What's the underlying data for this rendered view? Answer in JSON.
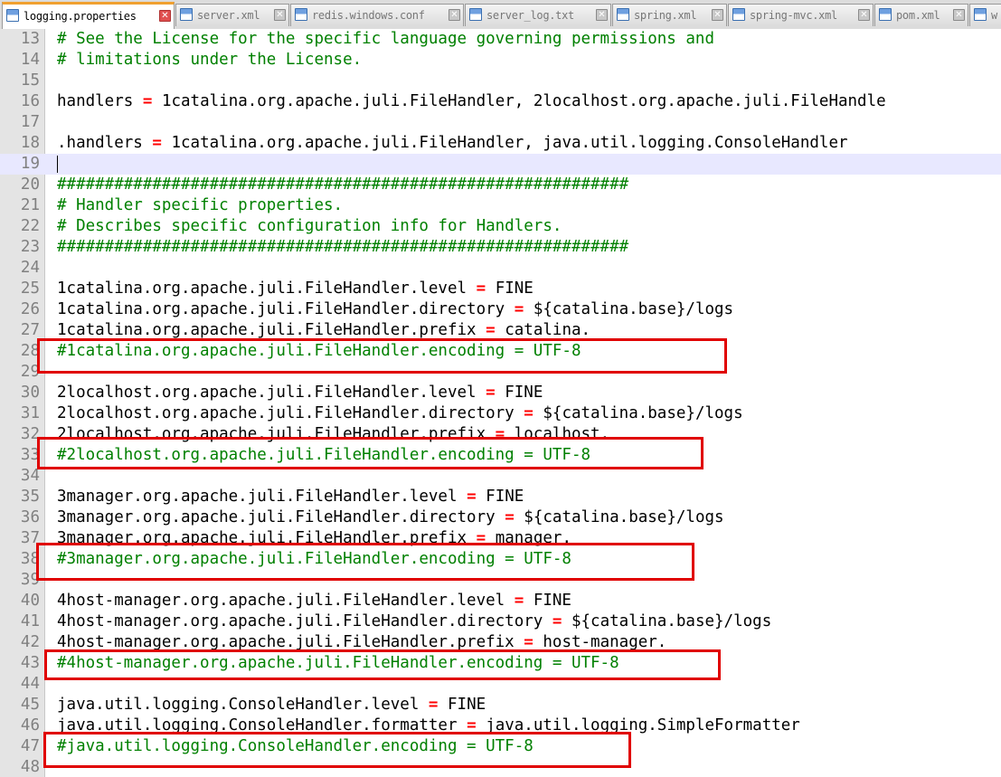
{
  "tabs": [
    {
      "label": "logging.properties",
      "active": true
    },
    {
      "label": "server.xml",
      "active": false
    },
    {
      "label": "redis.windows.conf",
      "active": false
    },
    {
      "label": "server_log.txt",
      "active": false
    },
    {
      "label": "spring.xml",
      "active": false
    },
    {
      "label": "spring-mvc.xml",
      "active": false
    },
    {
      "label": "pom.xml",
      "active": false
    },
    {
      "label": "w",
      "active": false
    }
  ],
  "colors": {
    "comment": "#008000",
    "operator": "#ff0000",
    "highlight_box": "#e00000",
    "current_line": "#e8e8ff"
  },
  "editor": {
    "current_line": "19",
    "lines": [
      {
        "num": "13",
        "comment": "# See the License for the specific language governing permissions and"
      },
      {
        "num": "14",
        "comment": "# limitations under the License."
      },
      {
        "num": "15"
      },
      {
        "num": "16",
        "key": "handlers",
        "op": "=",
        "value": "1catalina.org.apache.juli.FileHandler, 2localhost.org.apache.juli.FileHandle"
      },
      {
        "num": "17"
      },
      {
        "num": "18",
        "key": ".handlers",
        "op": "=",
        "value": "1catalina.org.apache.juli.FileHandler, java.util.logging.ConsoleHandler"
      },
      {
        "num": "19"
      },
      {
        "num": "20",
        "comment": "############################################################"
      },
      {
        "num": "21",
        "comment": "# Handler specific properties."
      },
      {
        "num": "22",
        "comment": "# Describes specific configuration info for Handlers."
      },
      {
        "num": "23",
        "comment": "############################################################"
      },
      {
        "num": "24"
      },
      {
        "num": "25",
        "key": "1catalina.org.apache.juli.FileHandler.level",
        "op": "=",
        "value": "FINE"
      },
      {
        "num": "26",
        "key": "1catalina.org.apache.juli.FileHandler.directory",
        "op": "=",
        "value": "${catalina.base}/logs"
      },
      {
        "num": "27",
        "key": "1catalina.org.apache.juli.FileHandler.prefix",
        "op": "=",
        "value": "catalina."
      },
      {
        "num": "28",
        "comment": "#1catalina.org.apache.juli.FileHandler.encoding = UTF-8"
      },
      {
        "num": "29"
      },
      {
        "num": "30",
        "key": "2localhost.org.apache.juli.FileHandler.level",
        "op": "=",
        "value": "FINE"
      },
      {
        "num": "31",
        "key": "2localhost.org.apache.juli.FileHandler.directory",
        "op": "=",
        "value": "${catalina.base}/logs"
      },
      {
        "num": "32",
        "key": "2localhost.org.apache.juli.FileHandler.prefix",
        "op": "=",
        "value": "localhost."
      },
      {
        "num": "33",
        "comment": "#2localhost.org.apache.juli.FileHandler.encoding = UTF-8"
      },
      {
        "num": "34"
      },
      {
        "num": "35",
        "key": "3manager.org.apache.juli.FileHandler.level",
        "op": "=",
        "value": "FINE"
      },
      {
        "num": "36",
        "key": "3manager.org.apache.juli.FileHandler.directory",
        "op": "=",
        "value": "${catalina.base}/logs"
      },
      {
        "num": "37",
        "key": "3manager.org.apache.juli.FileHandler.prefix",
        "op": "=",
        "value": "manager."
      },
      {
        "num": "38",
        "comment": "#3manager.org.apache.juli.FileHandler.encoding = UTF-8"
      },
      {
        "num": "39"
      },
      {
        "num": "40",
        "key": "4host-manager.org.apache.juli.FileHandler.level",
        "op": "=",
        "value": "FINE"
      },
      {
        "num": "41",
        "key": "4host-manager.org.apache.juli.FileHandler.directory",
        "op": "=",
        "value": "${catalina.base}/logs"
      },
      {
        "num": "42",
        "key": "4host-manager.org.apache.juli.FileHandler.prefix",
        "op": "=",
        "value": "host-manager."
      },
      {
        "num": "43",
        "comment": "#4host-manager.org.apache.juli.FileHandler.encoding = UTF-8"
      },
      {
        "num": "44"
      },
      {
        "num": "45",
        "key": "java.util.logging.ConsoleHandler.level",
        "op": "=",
        "value": "FINE"
      },
      {
        "num": "46",
        "key": "java.util.logging.ConsoleHandler.formatter",
        "op": "=",
        "value": "java.util.logging.SimpleFormatter"
      },
      {
        "num": "47",
        "comment": "#java.util.logging.ConsoleHandler.encoding = UTF-8"
      },
      {
        "num": "48"
      }
    ]
  }
}
